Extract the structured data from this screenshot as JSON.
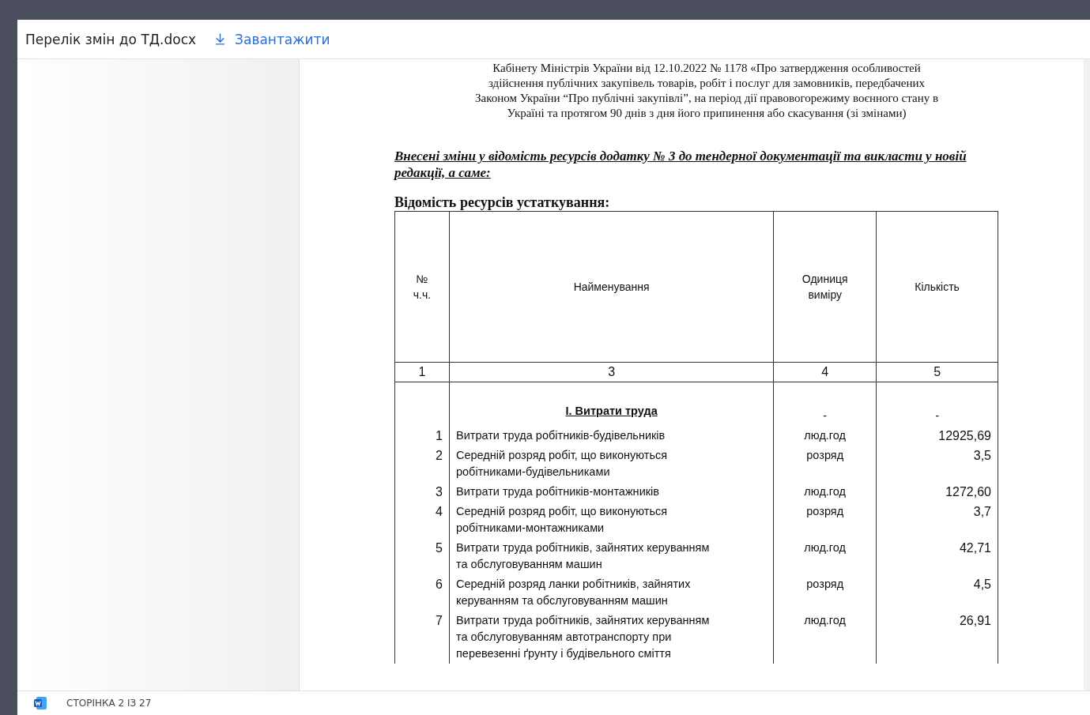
{
  "header": {
    "file_name": "Перелік змін до ТД.docx",
    "download_label": "Завантажити"
  },
  "document": {
    "intro_lines": [
      "Кабінету Міністрів України від 12.10.2022 № 1178 «Про затвердження особливостей",
      "здійснення публічних закупівель товарів, робіт і послуг для замовників, передбачених",
      "Законом України “Про публічні закупівлі”, на період дії правовогорежиму воєнного стану в",
      "Україні та протягом 90 днів з дня його припинення або скасування (зі змінами)"
    ],
    "changes_heading": "Внесені зміни у відомість ресурсів  додатку № 3 до тендерної документації та викласти у новій редакції, а саме:",
    "table_title": "Відомість ресурсів устаткування:",
    "table": {
      "columns": [
        "№ ч.ч.",
        "Найменування",
        "Одиниця виміру",
        "Кількість"
      ],
      "column_numbers": [
        "1",
        "3",
        "4",
        "5"
      ],
      "rows": [
        {
          "kind": "section",
          "name": "І. Витрати труда",
          "unit": "-",
          "qty": "-"
        },
        {
          "kind": "item",
          "num": "1",
          "name": "Витрати труда робітників-будівельників",
          "unit": "люд.год",
          "qty": "12925,69"
        },
        {
          "kind": "item",
          "num": "2",
          "name": "Середній розряд робіт, що виконуються робітниками-будівельниками",
          "unit": "розряд",
          "qty": "3,5"
        },
        {
          "kind": "item",
          "num": "3",
          "name": "Витрати труда робітників-монтажників",
          "unit": "люд.год",
          "qty": "1272,60"
        },
        {
          "kind": "item",
          "num": "4",
          "name": "Середній розряд робіт, що виконуються робітниками-монтажниками",
          "unit": "розряд",
          "qty": "3,7"
        },
        {
          "kind": "item",
          "num": "5",
          "name": "Витрати труда робітників, зайнятих керуванням та обслуговуванням машин",
          "unit": "люд.год",
          "qty": "42,71"
        },
        {
          "kind": "item",
          "num": "6",
          "name": "Середній розряд ланки робітників, зайнятих керуванням та обслуговуванням машин",
          "unit": "розряд",
          "qty": "4,5"
        },
        {
          "kind": "item",
          "num": "7",
          "name": "Витрати труда робітників, зайнятих керуванням та обслуговуванням автотранспорту при перевезенні ґрунту і будівельного сміття",
          "unit": "люд.год",
          "qty": "26,91"
        }
      ]
    }
  },
  "status_bar": {
    "page_label": "СТОРІНКА 2 ІЗ 27"
  }
}
